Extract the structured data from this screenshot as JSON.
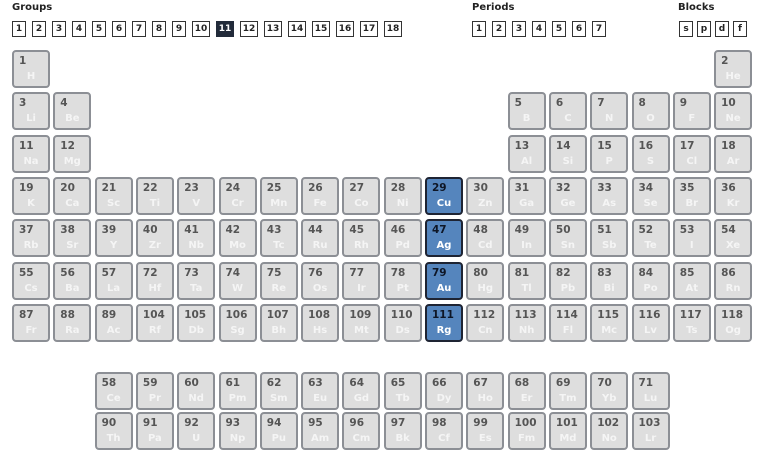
{
  "headers": {
    "groups": "Groups",
    "periods": "Periods",
    "blocks": "Blocks"
  },
  "groups": [
    "1",
    "2",
    "3",
    "4",
    "5",
    "6",
    "7",
    "8",
    "9",
    "10",
    "11",
    "12",
    "13",
    "14",
    "15",
    "16",
    "17",
    "18"
  ],
  "selected_group": "11",
  "periods": [
    "1",
    "2",
    "3",
    "4",
    "5",
    "6",
    "7"
  ],
  "blocks": [
    "s",
    "p",
    "d",
    "f"
  ],
  "colors": {
    "highlight": "#5585bd",
    "cell": "#dedede",
    "border": "#8c8f95",
    "active": "#222b3a"
  },
  "elements": [
    {
      "n": "1",
      "s": "H",
      "r": 1,
      "c": 1
    },
    {
      "n": "2",
      "s": "He",
      "r": 1,
      "c": 18
    },
    {
      "n": "3",
      "s": "Li",
      "r": 2,
      "c": 1
    },
    {
      "n": "4",
      "s": "Be",
      "r": 2,
      "c": 2
    },
    {
      "n": "5",
      "s": "B",
      "r": 2,
      "c": 13
    },
    {
      "n": "6",
      "s": "C",
      "r": 2,
      "c": 14
    },
    {
      "n": "7",
      "s": "N",
      "r": 2,
      "c": 15
    },
    {
      "n": "8",
      "s": "O",
      "r": 2,
      "c": 16
    },
    {
      "n": "9",
      "s": "F",
      "r": 2,
      "c": 17
    },
    {
      "n": "10",
      "s": "Ne",
      "r": 2,
      "c": 18
    },
    {
      "n": "11",
      "s": "Na",
      "r": 3,
      "c": 1
    },
    {
      "n": "12",
      "s": "Mg",
      "r": 3,
      "c": 2
    },
    {
      "n": "13",
      "s": "Al",
      "r": 3,
      "c": 13
    },
    {
      "n": "14",
      "s": "Si",
      "r": 3,
      "c": 14
    },
    {
      "n": "15",
      "s": "P",
      "r": 3,
      "c": 15
    },
    {
      "n": "16",
      "s": "S",
      "r": 3,
      "c": 16
    },
    {
      "n": "17",
      "s": "Cl",
      "r": 3,
      "c": 17
    },
    {
      "n": "18",
      "s": "Ar",
      "r": 3,
      "c": 18
    },
    {
      "n": "19",
      "s": "K",
      "r": 4,
      "c": 1
    },
    {
      "n": "20",
      "s": "Ca",
      "r": 4,
      "c": 2
    },
    {
      "n": "21",
      "s": "Sc",
      "r": 4,
      "c": 3
    },
    {
      "n": "22",
      "s": "Ti",
      "r": 4,
      "c": 4
    },
    {
      "n": "23",
      "s": "V",
      "r": 4,
      "c": 5
    },
    {
      "n": "24",
      "s": "Cr",
      "r": 4,
      "c": 6
    },
    {
      "n": "25",
      "s": "Mn",
      "r": 4,
      "c": 7
    },
    {
      "n": "26",
      "s": "Fe",
      "r": 4,
      "c": 8
    },
    {
      "n": "27",
      "s": "Co",
      "r": 4,
      "c": 9
    },
    {
      "n": "28",
      "s": "Ni",
      "r": 4,
      "c": 10
    },
    {
      "n": "29",
      "s": "Cu",
      "r": 4,
      "c": 11,
      "hl": true
    },
    {
      "n": "30",
      "s": "Zn",
      "r": 4,
      "c": 12
    },
    {
      "n": "31",
      "s": "Ga",
      "r": 4,
      "c": 13
    },
    {
      "n": "32",
      "s": "Ge",
      "r": 4,
      "c": 14
    },
    {
      "n": "33",
      "s": "As",
      "r": 4,
      "c": 15
    },
    {
      "n": "34",
      "s": "Se",
      "r": 4,
      "c": 16
    },
    {
      "n": "35",
      "s": "Br",
      "r": 4,
      "c": 17
    },
    {
      "n": "36",
      "s": "Kr",
      "r": 4,
      "c": 18
    },
    {
      "n": "37",
      "s": "Rb",
      "r": 5,
      "c": 1
    },
    {
      "n": "38",
      "s": "Sr",
      "r": 5,
      "c": 2
    },
    {
      "n": "39",
      "s": "Y",
      "r": 5,
      "c": 3
    },
    {
      "n": "40",
      "s": "Zr",
      "r": 5,
      "c": 4
    },
    {
      "n": "41",
      "s": "Nb",
      "r": 5,
      "c": 5
    },
    {
      "n": "42",
      "s": "Mo",
      "r": 5,
      "c": 6
    },
    {
      "n": "43",
      "s": "Tc",
      "r": 5,
      "c": 7
    },
    {
      "n": "44",
      "s": "Ru",
      "r": 5,
      "c": 8
    },
    {
      "n": "45",
      "s": "Rh",
      "r": 5,
      "c": 9
    },
    {
      "n": "46",
      "s": "Pd",
      "r": 5,
      "c": 10
    },
    {
      "n": "47",
      "s": "Ag",
      "r": 5,
      "c": 11,
      "hl": true
    },
    {
      "n": "48",
      "s": "Cd",
      "r": 5,
      "c": 12
    },
    {
      "n": "49",
      "s": "In",
      "r": 5,
      "c": 13
    },
    {
      "n": "50",
      "s": "Sn",
      "r": 5,
      "c": 14
    },
    {
      "n": "51",
      "s": "Sb",
      "r": 5,
      "c": 15
    },
    {
      "n": "52",
      "s": "Te",
      "r": 5,
      "c": 16
    },
    {
      "n": "53",
      "s": "I",
      "r": 5,
      "c": 17
    },
    {
      "n": "54",
      "s": "Xe",
      "r": 5,
      "c": 18
    },
    {
      "n": "55",
      "s": "Cs",
      "r": 6,
      "c": 1
    },
    {
      "n": "56",
      "s": "Ba",
      "r": 6,
      "c": 2
    },
    {
      "n": "57",
      "s": "La",
      "r": 6,
      "c": 3
    },
    {
      "n": "72",
      "s": "Hf",
      "r": 6,
      "c": 4
    },
    {
      "n": "73",
      "s": "Ta",
      "r": 6,
      "c": 5
    },
    {
      "n": "74",
      "s": "W",
      "r": 6,
      "c": 6
    },
    {
      "n": "75",
      "s": "Re",
      "r": 6,
      "c": 7
    },
    {
      "n": "76",
      "s": "Os",
      "r": 6,
      "c": 8
    },
    {
      "n": "77",
      "s": "Ir",
      "r": 6,
      "c": 9
    },
    {
      "n": "78",
      "s": "Pt",
      "r": 6,
      "c": 10
    },
    {
      "n": "79",
      "s": "Au",
      "r": 6,
      "c": 11,
      "hl": true
    },
    {
      "n": "80",
      "s": "Hg",
      "r": 6,
      "c": 12
    },
    {
      "n": "81",
      "s": "Tl",
      "r": 6,
      "c": 13
    },
    {
      "n": "82",
      "s": "Pb",
      "r": 6,
      "c": 14
    },
    {
      "n": "83",
      "s": "Bi",
      "r": 6,
      "c": 15
    },
    {
      "n": "84",
      "s": "Po",
      "r": 6,
      "c": 16
    },
    {
      "n": "85",
      "s": "At",
      "r": 6,
      "c": 17
    },
    {
      "n": "86",
      "s": "Rn",
      "r": 6,
      "c": 18
    },
    {
      "n": "87",
      "s": "Fr",
      "r": 7,
      "c": 1
    },
    {
      "n": "88",
      "s": "Ra",
      "r": 7,
      "c": 2
    },
    {
      "n": "89",
      "s": "Ac",
      "r": 7,
      "c": 3
    },
    {
      "n": "104",
      "s": "Rf",
      "r": 7,
      "c": 4
    },
    {
      "n": "105",
      "s": "Db",
      "r": 7,
      "c": 5
    },
    {
      "n": "106",
      "s": "Sg",
      "r": 7,
      "c": 6
    },
    {
      "n": "107",
      "s": "Bh",
      "r": 7,
      "c": 7
    },
    {
      "n": "108",
      "s": "Hs",
      "r": 7,
      "c": 8
    },
    {
      "n": "109",
      "s": "Mt",
      "r": 7,
      "c": 9
    },
    {
      "n": "110",
      "s": "Ds",
      "r": 7,
      "c": 10
    },
    {
      "n": "111",
      "s": "Rg",
      "r": 7,
      "c": 11,
      "hl": true
    },
    {
      "n": "112",
      "s": "Cn",
      "r": 7,
      "c": 12
    },
    {
      "n": "113",
      "s": "Nh",
      "r": 7,
      "c": 13
    },
    {
      "n": "114",
      "s": "Fl",
      "r": 7,
      "c": 14
    },
    {
      "n": "115",
      "s": "Mc",
      "r": 7,
      "c": 15
    },
    {
      "n": "116",
      "s": "Lv",
      "r": 7,
      "c": 16
    },
    {
      "n": "117",
      "s": "Ts",
      "r": 7,
      "c": 17
    },
    {
      "n": "118",
      "s": "Og",
      "r": 7,
      "c": 18
    },
    {
      "n": "58",
      "s": "Ce",
      "r": 9,
      "c": 3
    },
    {
      "n": "59",
      "s": "Pr",
      "r": 9,
      "c": 4
    },
    {
      "n": "60",
      "s": "Nd",
      "r": 9,
      "c": 5
    },
    {
      "n": "61",
      "s": "Pm",
      "r": 9,
      "c": 6
    },
    {
      "n": "62",
      "s": "Sm",
      "r": 9,
      "c": 7
    },
    {
      "n": "63",
      "s": "Eu",
      "r": 9,
      "c": 8
    },
    {
      "n": "64",
      "s": "Gd",
      "r": 9,
      "c": 9
    },
    {
      "n": "65",
      "s": "Tb",
      "r": 9,
      "c": 10
    },
    {
      "n": "66",
      "s": "Dy",
      "r": 9,
      "c": 11
    },
    {
      "n": "67",
      "s": "Ho",
      "r": 9,
      "c": 12
    },
    {
      "n": "68",
      "s": "Er",
      "r": 9,
      "c": 13
    },
    {
      "n": "69",
      "s": "Tm",
      "r": 9,
      "c": 14
    },
    {
      "n": "70",
      "s": "Yb",
      "r": 9,
      "c": 15
    },
    {
      "n": "71",
      "s": "Lu",
      "r": 9,
      "c": 16
    },
    {
      "n": "90",
      "s": "Th",
      "r": 10,
      "c": 3
    },
    {
      "n": "91",
      "s": "Pa",
      "r": 10,
      "c": 4
    },
    {
      "n": "92",
      "s": "U",
      "r": 10,
      "c": 5
    },
    {
      "n": "93",
      "s": "Np",
      "r": 10,
      "c": 6
    },
    {
      "n": "94",
      "s": "Pu",
      "r": 10,
      "c": 7
    },
    {
      "n": "95",
      "s": "Am",
      "r": 10,
      "c": 8
    },
    {
      "n": "96",
      "s": "Cm",
      "r": 10,
      "c": 9
    },
    {
      "n": "97",
      "s": "Bk",
      "r": 10,
      "c": 10
    },
    {
      "n": "98",
      "s": "Cf",
      "r": 10,
      "c": 11
    },
    {
      "n": "99",
      "s": "Es",
      "r": 10,
      "c": 12
    },
    {
      "n": "100",
      "s": "Fm",
      "r": 10,
      "c": 13
    },
    {
      "n": "101",
      "s": "Md",
      "r": 10,
      "c": 14
    },
    {
      "n": "102",
      "s": "No",
      "r": 10,
      "c": 15
    },
    {
      "n": "103",
      "s": "Lr",
      "r": 10,
      "c": 16
    }
  ]
}
